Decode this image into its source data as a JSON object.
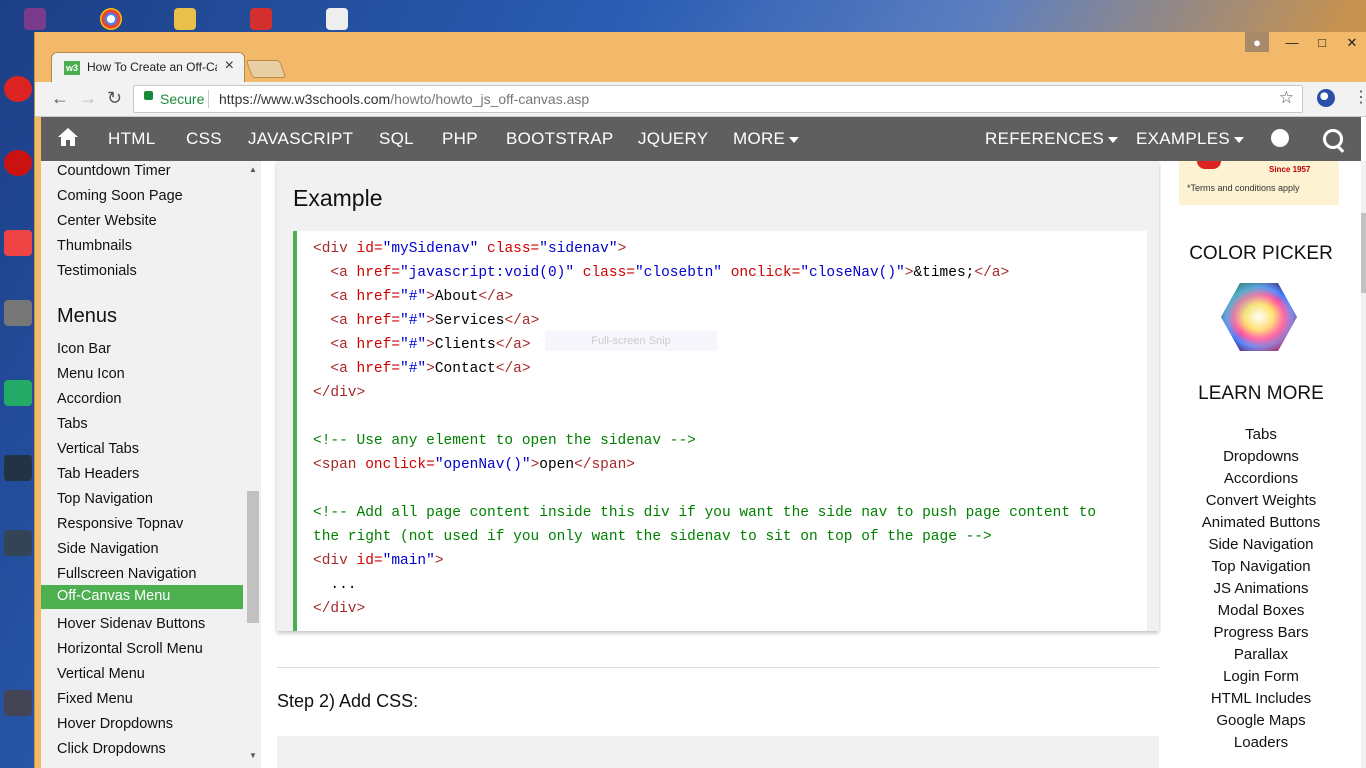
{
  "window": {
    "tab_title": "How To Create an Off-Ca",
    "tab_favicon": "w3",
    "tab_close": "×"
  },
  "address_bar": {
    "secure_label": "Secure",
    "url_scheme": "https://",
    "url_host": "www.w3schools.com",
    "url_path": "/howto/howto_js_off-canvas.asp"
  },
  "topnav": {
    "items": [
      "HTML",
      "CSS",
      "JAVASCRIPT",
      "SQL",
      "PHP",
      "BOOTSTRAP",
      "JQUERY",
      "MORE",
      "REFERENCES",
      "EXAMPLES"
    ]
  },
  "sidebar": {
    "top_links": [
      "Countdown Timer",
      "Coming Soon Page",
      "Center Website",
      "Thumbnails",
      "Testimonials"
    ],
    "heading": "Menus",
    "menu_links": [
      "Icon Bar",
      "Menu Icon",
      "Accordion",
      "Tabs",
      "Vertical Tabs",
      "Tab Headers",
      "Top Navigation",
      "Responsive Topnav",
      "Side Navigation",
      "Fullscreen Navigation",
      "Off-Canvas Menu",
      "Hover Sidenav Buttons",
      "Horizontal Scroll Menu",
      "Vertical Menu",
      "Fixed Menu",
      "Hover Dropdowns",
      "Click Dropdowns"
    ],
    "active": "Off-Canvas Menu"
  },
  "main": {
    "example_title": "Example",
    "snip_overlay": "Full-screen Snip",
    "step_title": "Step 2) Add CSS:"
  },
  "right": {
    "ad_since": "Since 1957",
    "ad_text": "*Terms and conditions apply",
    "color_picker_title": "COLOR PICKER",
    "learn_more_title": "LEARN MORE",
    "learn_more_links": [
      "Tabs",
      "Dropdowns",
      "Accordions",
      "Convert Weights",
      "Animated Buttons",
      "Side Navigation",
      "Top Navigation",
      "JS Animations",
      "Modal Boxes",
      "Progress Bars",
      "Parallax",
      "Login Form",
      "HTML Includes",
      "Google Maps",
      "Loaders"
    ]
  },
  "colors": {
    "accent_green": "#4caf50",
    "topnav_bg": "#5f5f5f",
    "window_frame": "#f3b96b"
  }
}
